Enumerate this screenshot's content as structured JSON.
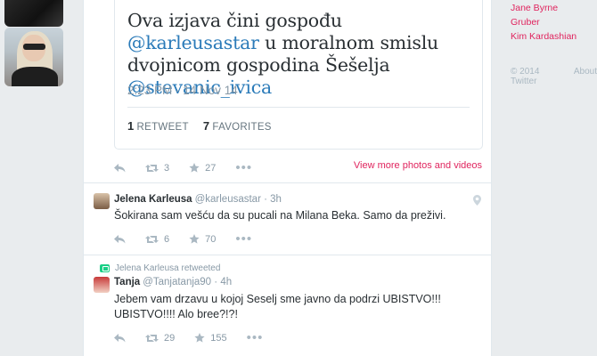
{
  "sidebar_right": {
    "links": [
      "Jane Byrne",
      "Gruber",
      "Kim Kardashian"
    ],
    "copyright": "© 2014 Twitter",
    "about": "About"
  },
  "quoted_tweet": {
    "text_before": "Ova izjava čini gospođu ",
    "mention1": "@karleusastar",
    "text_middle": " u moralnom smislu dvojnicom gospodina Šešelja ",
    "mention2": "@stevanic_ivica",
    "timestamp": "2:23 PM · 14 Nov 14",
    "retweets_count": "1",
    "retweets_label": "RETWEET",
    "favorites_count": "7",
    "favorites_label": "FAVORITES"
  },
  "first_actions": {
    "retweets": "3",
    "favorites": "27"
  },
  "view_more_link": "View more photos and videos",
  "tweets": [
    {
      "name": "Jelena Karleusa",
      "handle": "@karleusastar",
      "time": "· 3h",
      "text": "Šokirana sam vešću da su pucali na Milana Beka. Samo da preživi.",
      "retweets": "6",
      "favorites": "70"
    },
    {
      "retweeted_by": "Jelena Karleusa retweeted",
      "name": "Tanja",
      "handle": "@Tanjatanja90",
      "time": "· 4h",
      "text": "Jebem vam drzavu u kojoj Seselj sme javno da podrzi UBISTVO!!! UBISTVO!!!! Alo bree?!?!",
      "retweets": "29",
      "favorites": "155"
    }
  ],
  "colors": {
    "link_blue": "#2b7bb9",
    "accent_pink": "#e0245e",
    "muted": "#8899a6",
    "retweet_green": "#19cf86"
  },
  "icons": [
    "reply-icon",
    "retweet-icon",
    "favorite-star-icon",
    "more-options-icon",
    "location-pin-icon"
  ]
}
